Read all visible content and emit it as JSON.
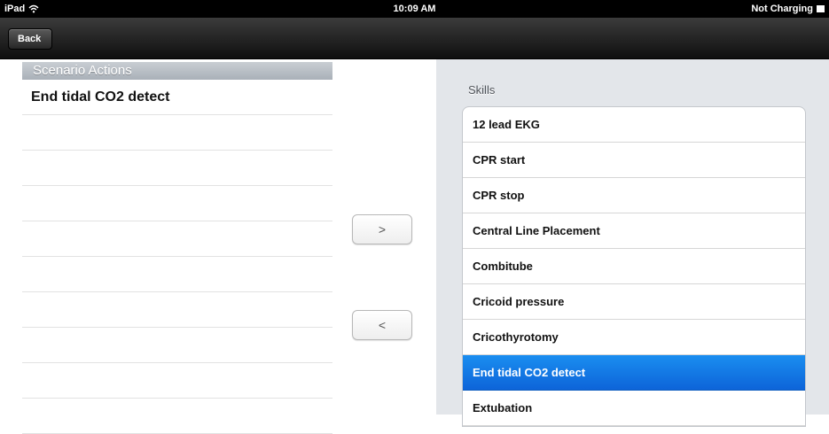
{
  "status_bar": {
    "device": "iPad",
    "time": "10:09 AM",
    "battery_text": "Not Charging"
  },
  "nav": {
    "back_label": "Back"
  },
  "scenario_actions": {
    "header": "Scenario Actions",
    "items": [
      "End tidal CO2 detect",
      "",
      "",
      "",
      "",
      "",
      "",
      "",
      "",
      ""
    ]
  },
  "buttons": {
    "add_label": ">",
    "remove_label": "<"
  },
  "skills": {
    "header": "Skills",
    "items": [
      "12 lead EKG",
      "CPR start",
      "CPR stop",
      "Central Line Placement",
      "Combitube",
      "Cricoid pressure",
      "Cricothyrotomy",
      "End tidal CO2 detect",
      "Extubation"
    ],
    "selected": "End tidal CO2 detect",
    "selected_color": "#0f6fe0"
  }
}
